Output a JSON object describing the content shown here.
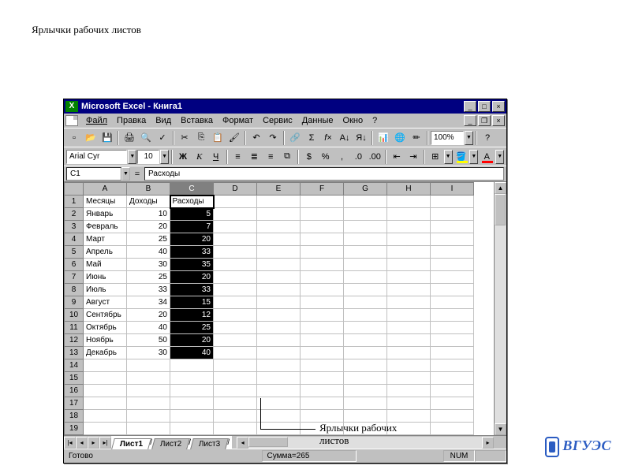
{
  "page": {
    "heading": "Ярлычки рабочих листов",
    "annotation": "Ярлычки рабочих\nлистов",
    "logo": "ВГУЭС"
  },
  "titlebar": {
    "title": "Microsoft Excel - Книга1"
  },
  "menubar": {
    "file": "Файл",
    "edit": "Правка",
    "view": "Вид",
    "insert": "Вставка",
    "format": "Формат",
    "service": "Сервис",
    "data": "Данные",
    "window": "Окно",
    "help": "?"
  },
  "toolbar": {
    "font": "Arial Cyr",
    "size": "10",
    "zoom": "100%",
    "bold": "Ж",
    "italic": "К",
    "under": "Ч"
  },
  "formula": {
    "name": "C1",
    "value": "Расходы"
  },
  "columns": [
    "A",
    "B",
    "C",
    "D",
    "E",
    "F",
    "G",
    "H",
    "I"
  ],
  "rows": [
    {
      "n": "1",
      "a": "Месяцы",
      "b": "Доходы",
      "c": "Расходы",
      "cnum": false
    },
    {
      "n": "2",
      "a": "Январь",
      "b": "10",
      "c": "5"
    },
    {
      "n": "3",
      "a": "Февраль",
      "b": "20",
      "c": "7"
    },
    {
      "n": "4",
      "a": "Март",
      "b": "25",
      "c": "20"
    },
    {
      "n": "5",
      "a": "Апрель",
      "b": "40",
      "c": "33"
    },
    {
      "n": "6",
      "a": "Май",
      "b": "30",
      "c": "35"
    },
    {
      "n": "7",
      "a": "Июнь",
      "b": "25",
      "c": "20"
    },
    {
      "n": "8",
      "a": "Июль",
      "b": "33",
      "c": "33"
    },
    {
      "n": "9",
      "a": "Август",
      "b": "34",
      "c": "15"
    },
    {
      "n": "10",
      "a": "Сентябрь",
      "b": "20",
      "c": "12"
    },
    {
      "n": "11",
      "a": "Октябрь",
      "b": "40",
      "c": "25"
    },
    {
      "n": "12",
      "a": "Ноябрь",
      "b": "50",
      "c": "20"
    },
    {
      "n": "13",
      "a": "Декабрь",
      "b": "30",
      "c": "40"
    }
  ],
  "empty_rows": [
    "14",
    "15",
    "16",
    "17",
    "18",
    "19"
  ],
  "tabs": {
    "t1": "Лист1",
    "t2": "Лист2",
    "t3": "Лист3"
  },
  "status": {
    "ready": "Готово",
    "sum": "Сумма=265",
    "num": "NUM"
  }
}
